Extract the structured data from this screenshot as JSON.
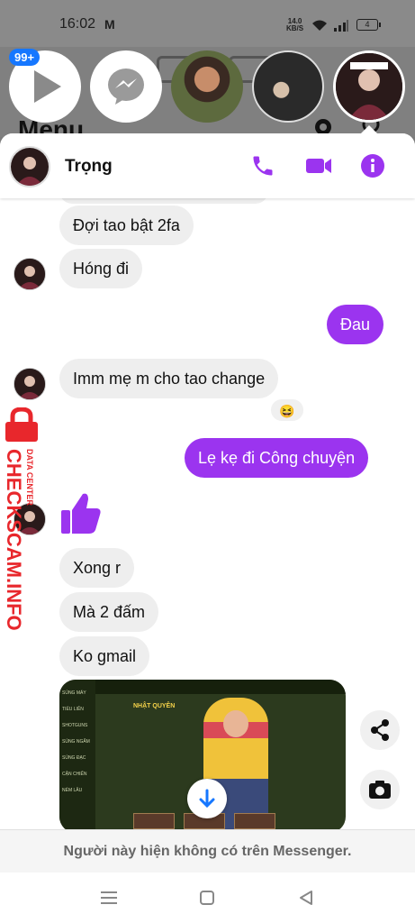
{
  "status_bar": {
    "time": "16:02",
    "carrier_icon": "M",
    "speed_value": "14.0",
    "speed_unit": "KB/S",
    "battery": "4"
  },
  "background_app": {
    "menu_title": "Menu",
    "chat_head_badge": "99+"
  },
  "chat": {
    "contact_name": "Trọng",
    "accent_color": "#9b34ef",
    "messages": [
      {
        "from": "them",
        "text": "Đợi tao bật 2fa"
      },
      {
        "from": "them",
        "text": "Hóng  đi"
      },
      {
        "from": "me",
        "text": "Đau"
      },
      {
        "from": "them",
        "text": "Imm mẹ m cho tao change",
        "reaction": "😆"
      },
      {
        "from": "me",
        "text": "Lẹ kẹ đi Công chuyện"
      },
      {
        "from": "them",
        "type": "like",
        "icon": "thumbs-up-icon"
      },
      {
        "from": "them",
        "text": "Xong r"
      },
      {
        "from": "them",
        "text": "Mà 2 đấm"
      },
      {
        "from": "them",
        "text": "Ko gmail"
      },
      {
        "from": "them",
        "type": "image",
        "icon": "game-screenshot"
      }
    ],
    "footer_notice": "Người này hiện không có trên Messenger."
  },
  "media": {
    "title_text": "NHẬT QUYÊN",
    "side_menu": [
      "SÚNG MÁY",
      "TIỂU LIÊN",
      "SHOTGUNS",
      "SÚNG NGẮM",
      "SÚNG ĐẠC",
      "CẬN CHIẾN",
      "NÉM LÂU"
    ]
  },
  "watermark": {
    "main": "CHECKSCAM.INFO",
    "sub": "DATA CENTER"
  }
}
